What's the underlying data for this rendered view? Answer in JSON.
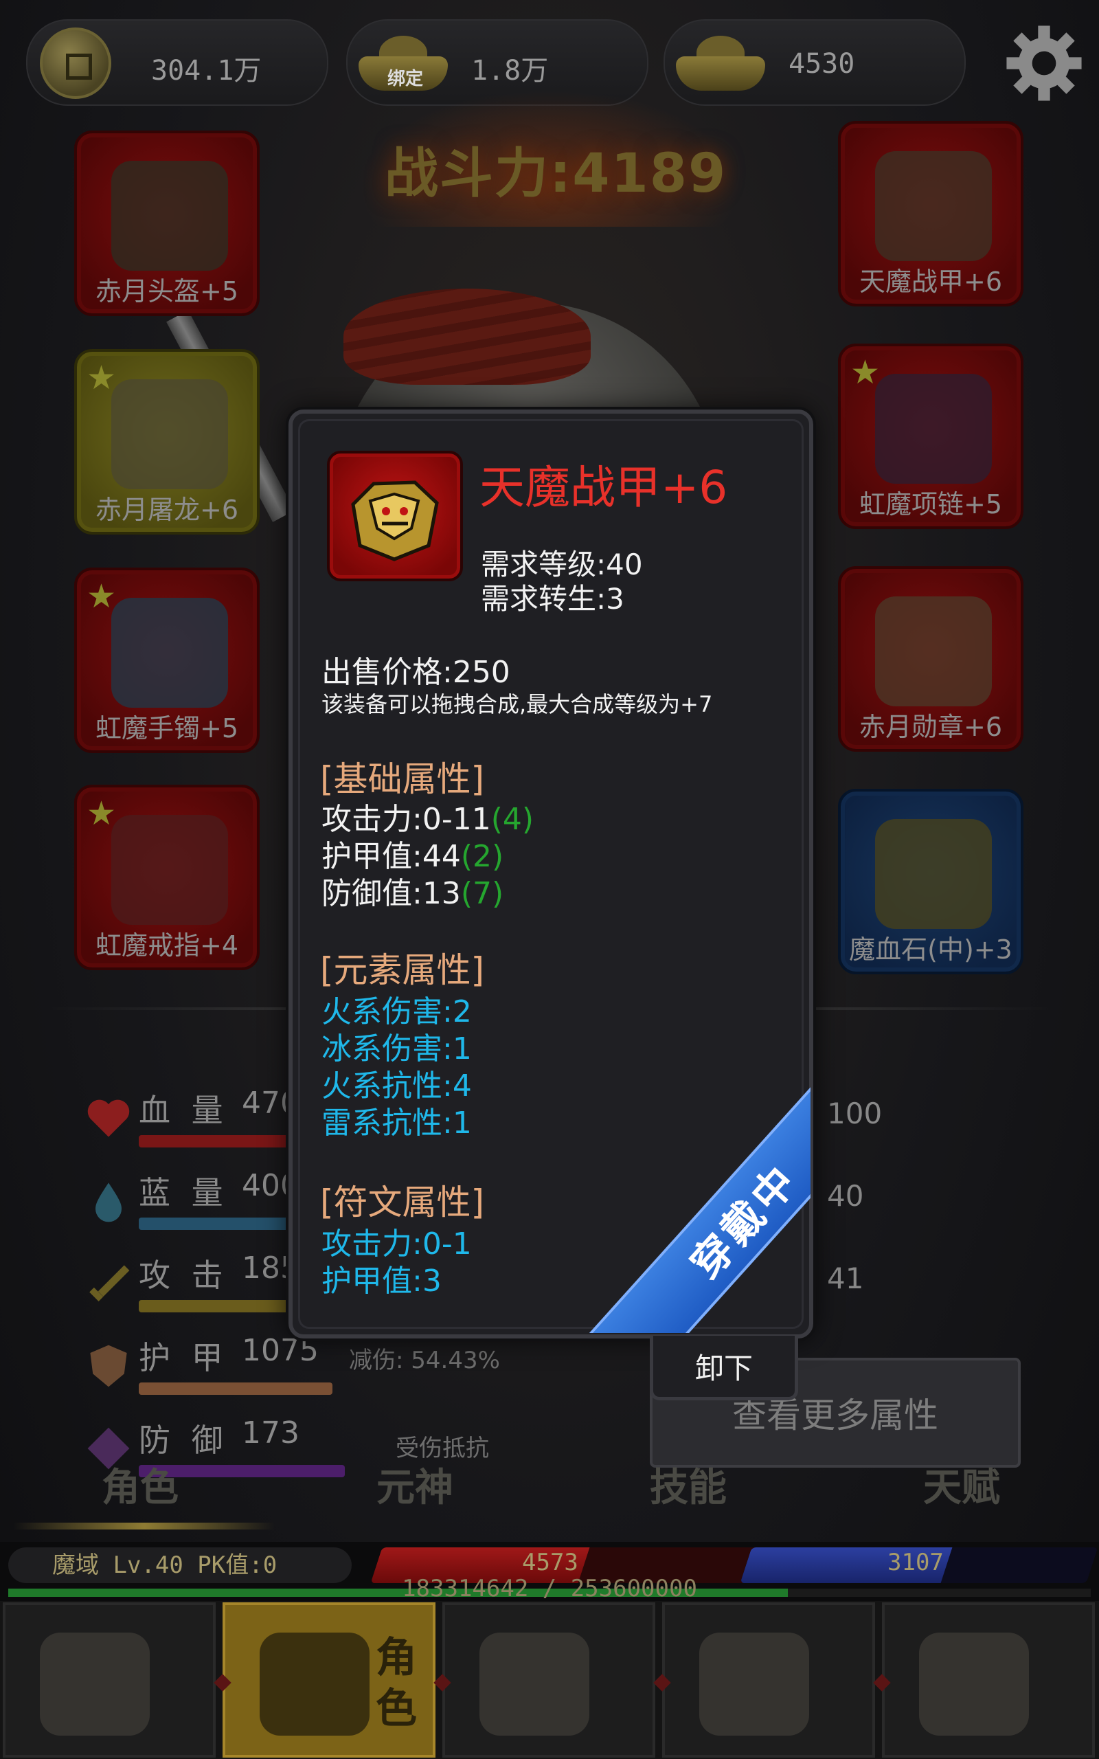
{
  "currency": {
    "coins": "304.1万",
    "bound_ingot_tag": "绑定",
    "bound_ingots": "1.8万",
    "ingots": "4530"
  },
  "combat_power": "战斗力:4189",
  "equipment": {
    "left": [
      {
        "label": "赤月头盔+5",
        "starred": false
      },
      {
        "label": "赤月屠龙+6",
        "starred": true
      },
      {
        "label": "虹魔手镯+5",
        "starred": true
      },
      {
        "label": "虹魔戒指+4",
        "starred": true
      }
    ],
    "right": [
      {
        "label": "天魔战甲+6",
        "starred": false
      },
      {
        "label": "虹魔项链+5",
        "starred": true
      },
      {
        "label": "赤月勋章+6",
        "starred": false
      },
      {
        "label": "魔血石(中)+3",
        "starred": false
      }
    ]
  },
  "stats": [
    {
      "name": "血 量",
      "value": "470",
      "color": "#8c1e1e"
    },
    {
      "name": "蓝 量",
      "value": "400",
      "color": "#2a5a7a"
    },
    {
      "name": "攻 击",
      "value": "185",
      "color": "#7a6a1e"
    },
    {
      "name": "护 甲",
      "value": "1075",
      "color": "#8a5a3a",
      "sub": "减伤: 54.43%"
    },
    {
      "name": "防 御",
      "value": "173",
      "color": "#5a2a7a",
      "sub": "受伤抵抗"
    }
  ],
  "right_values": [
    "100",
    "40",
    "41"
  ],
  "more_button": "查看更多属性",
  "tabs": [
    "角色",
    "元神",
    "技能",
    "天赋"
  ],
  "status": {
    "level_text": "魔域  Lv.40 PK值:0",
    "hp": "4573",
    "hp_fill": 0.54,
    "mp": "3107",
    "mp_fill": 0.58,
    "xp_text": "183314642 / 253600000",
    "xp_fill": 0.72
  },
  "nav": {
    "active_label_1": "角",
    "active_label_2": "色"
  },
  "tooltip": {
    "name": "天魔战甲+6",
    "req_level": "需求等级:40",
    "req_rebirth": "需求转生:3",
    "price": "出售价格:250",
    "note": "该装备可以拖拽合成,最大合成等级为+7",
    "base_title": "[基础属性]",
    "base": [
      {
        "text": "攻击力:0-11",
        "bonus": "(4)"
      },
      {
        "text": "护甲值:44",
        "bonus": "(2)"
      },
      {
        "text": "防御值:13",
        "bonus": "(7)"
      }
    ],
    "element_title": "[元素属性]",
    "element": [
      "火系伤害:2",
      "冰系伤害:1",
      "火系抗性:4",
      "雷系抗性:1"
    ],
    "rune_title": "[符文属性]",
    "rune": [
      "攻击力:0-1",
      "护甲值:3"
    ],
    "equipped_ribbon": "穿戴中",
    "unequip_button": "卸下"
  },
  "colors": {
    "item_name": "#e8312a",
    "section": "#e6a97c",
    "elemental": "#1fb8ea",
    "bonus": "#25a62f",
    "ribbon": "#2f6fd6"
  }
}
